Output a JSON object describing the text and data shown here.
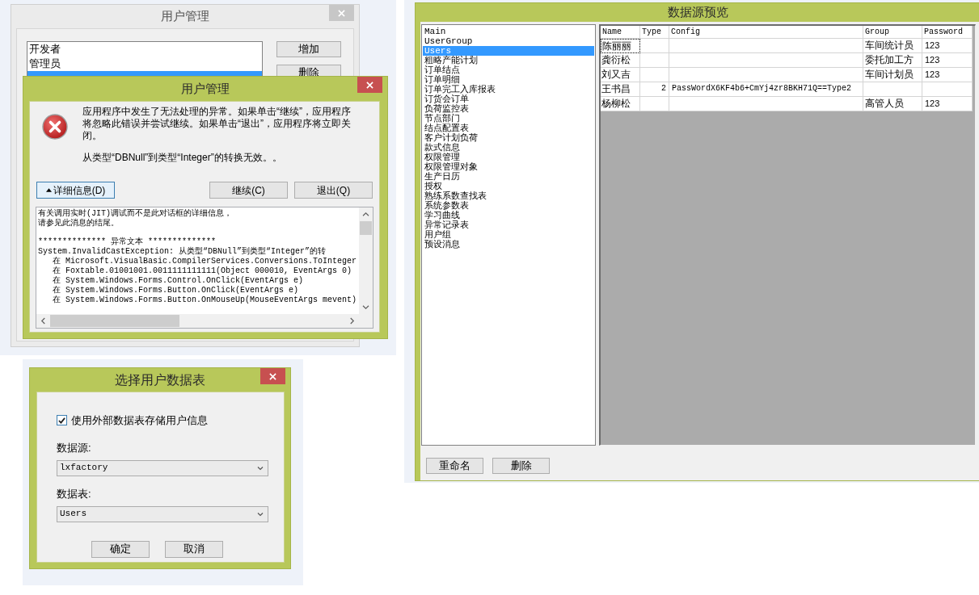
{
  "user_management_window": {
    "title": "用户管理",
    "active": false,
    "users": [
      {
        "label": "开发者",
        "selected": false
      },
      {
        "label": "管理员",
        "selected": false
      },
      {
        "selected": true
      }
    ],
    "buttons": [
      "增加",
      "删除"
    ]
  },
  "error_dialog": {
    "title": "用户管理",
    "active": true,
    "message": "应用程序中发生了无法处理的异常。如果单击“继续”，应用程序将忽略此错误并尝试继续。如果单击“退出”，应用程序将立即关闭。",
    "error": "从类型“DBNull”到类型“Integer”的转换无效。。",
    "details_button": {
      "label": "详细信息(D)",
      "focused": true
    },
    "buttons": [
      "继续(C)",
      "退出(Q)"
    ],
    "details": [
      {
        "kind": "text",
        "text": "有关调用实时(JIT)调试而不是此对话框的详细信息，"
      },
      {
        "kind": "text",
        "text": "请参见此消息的结尾。"
      },
      {
        "kind": "heading",
        "text": "************** 异常文本 **************"
      },
      {
        "kind": "text",
        "text": "System.InvalidCastException: 从类型“DBNull”到类型“Integer”的转"
      },
      {
        "kind": "frame",
        "text": "在 Microsoft.VisualBasic.CompilerServices.Conversions.ToInteger"
      },
      {
        "kind": "frame",
        "text": "在 Foxtable.01001001.0011111111111(Object 000010, EventArgs 0)"
      },
      {
        "kind": "frame",
        "text": "在 System.Windows.Forms.Control.OnClick(EventArgs e)"
      },
      {
        "kind": "frame",
        "text": "在 System.Windows.Forms.Button.OnClick(EventArgs e)"
      },
      {
        "kind": "frame",
        "text": "在 System.Windows.Forms.Button.OnMouseUp(MouseEventArgs mevent)"
      }
    ]
  },
  "select_user_table_dialog": {
    "title": "选择用户数据表",
    "active": true,
    "use_external": {
      "label": "使用外部数据表存储用户信息",
      "checked": true
    },
    "data_source": {
      "label": "数据源:",
      "value": "lxfactory"
    },
    "data_table": {
      "label": "数据表:",
      "value": "Users"
    },
    "buttons": [
      "确定",
      "取消"
    ]
  },
  "data_source_preview": {
    "title": "数据源预览",
    "active": true,
    "tables": [
      {
        "label": "Main",
        "selected": false
      },
      {
        "label": "UserGroup",
        "selected": false
      },
      {
        "label": "Users",
        "selected": true
      },
      {
        "label": "粗略产能计划",
        "selected": false
      },
      {
        "label": "订单结点",
        "selected": false
      },
      {
        "label": "订单明细",
        "selected": false
      },
      {
        "label": "订单完工入库报表",
        "selected": false
      },
      {
        "label": "订货会订单",
        "selected": false
      },
      {
        "label": "负荷监控表",
        "selected": false
      },
      {
        "label": "节点部门",
        "selected": false
      },
      {
        "label": "结点配置表",
        "selected": false
      },
      {
        "label": "客户计划负荷",
        "selected": false
      },
      {
        "label": "款式信息",
        "selected": false
      },
      {
        "label": "权限管理",
        "selected": false
      },
      {
        "label": "权限管理对象",
        "selected": false
      },
      {
        "label": "生产日历",
        "selected": false
      },
      {
        "label": "授权",
        "selected": false
      },
      {
        "label": "熟练系数查找表",
        "selected": false
      },
      {
        "label": "系统参数表",
        "selected": false
      },
      {
        "label": "学习曲线",
        "selected": false
      },
      {
        "label": "异常记录表",
        "selected": false
      },
      {
        "label": "用户组",
        "selected": false
      },
      {
        "label": "预设消息",
        "selected": false
      }
    ],
    "grid": {
      "columns": [
        "Name",
        "Type",
        "Config",
        "Group",
        "Password"
      ],
      "rows": [
        {
          "name": "陈丽丽",
          "group": "车间统计员",
          "password": "123",
          "focused": true
        },
        {
          "name": "龚衍松",
          "group": "委托加工方",
          "password": "123",
          "focused": false
        },
        {
          "name": "刘又吉",
          "group": "车间计划员",
          "password": "123",
          "focused": false
        },
        {
          "name": "王书昌",
          "type": "2",
          "config": "PassWordX6KF4b6+CmYj4zr8BKH71Q==Type2",
          "focused": false
        },
        {
          "name": "杨柳松",
          "group": "高管人员",
          "password": "123",
          "focused": false
        }
      ]
    },
    "buttons": [
      "重命名",
      "删除"
    ]
  }
}
